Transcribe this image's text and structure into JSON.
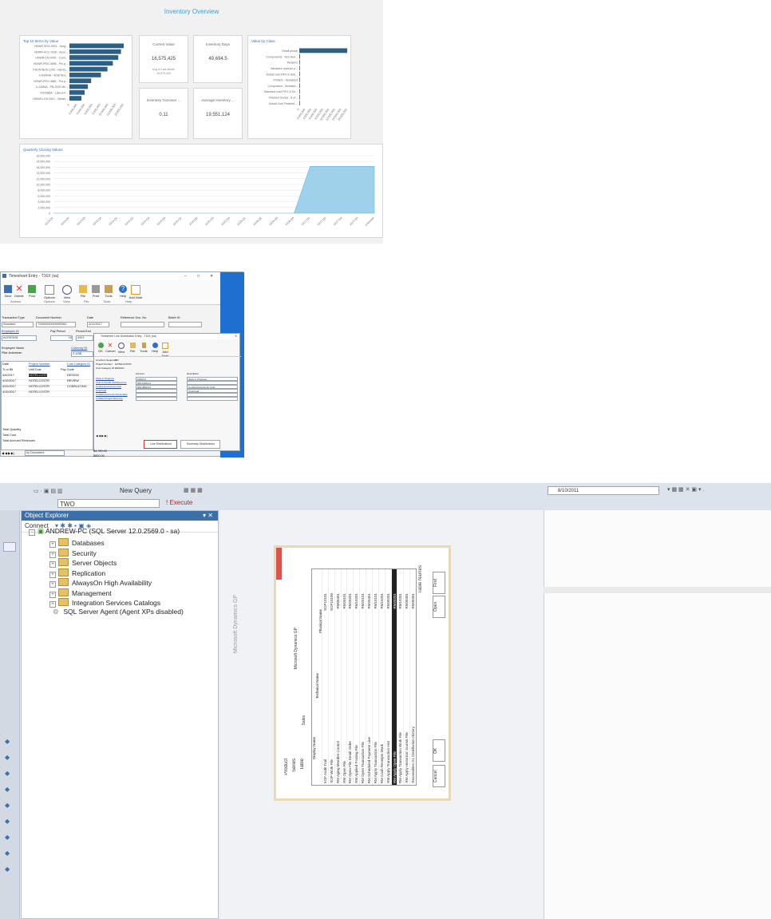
{
  "dashboard": {
    "title": "Inventory Overview",
    "top10": {
      "title": "Top 10 Items by Value",
      "items": [
        "HDWR-SRG-0001 - Surg...",
        "HDWR-ACC-0100 - Acce...",
        "HDWR-CM-0001 - Comi...",
        "HDWR-PRO-4896 - Pro p...",
        "PHON-BUS-1200 - Hands...",
        "2-A3954A - 4238 Sha...",
        "HDWR-PRO-4882 - Pro p...",
        "3-J2384A - PB-2320 Mo...",
        "4-B3386A - Lateral F...",
        "HDWR-LDS-0001 - Netwo..."
      ],
      "values": [
        100,
        95,
        90,
        80,
        70,
        58,
        40,
        34,
        28,
        22
      ],
      "x_ticks": [
        "0",
        "2,000,000",
        "4,000,000",
        "6,000,000",
        "8,000,000",
        "10,000,000",
        "12,000,000",
        "14,000,000"
      ]
    },
    "current_value": {
      "title": "Current Value",
      "value": "16,575,425",
      "sub1": "Avg of Last Month",
      "sub2": "16,875,425"
    },
    "inventory_days": {
      "title": "Inventory Days",
      "value": "49,694.5"
    },
    "turnover": {
      "title": "Inventory Turnover ...",
      "value": "0.11"
    },
    "avg_inventory": {
      "title": "Average Inventory ...",
      "value": "19,551,124"
    },
    "by_class": {
      "title": "Value by Class",
      "items": [
        "Retail phone",
        "Components - Non Seri...",
        "Modems",
        "Attractive contract p...",
        "Actual cost FIFO & Sub...",
        "Printers - Serialized",
        "Component - Serialize...",
        "Standard cost FIFO & Su...",
        "Finished Goods - 8 of...",
        "Actual Cost Finished ..."
      ],
      "values": [
        100,
        1.5,
        1,
        1,
        1,
        0.5,
        0.5,
        0.5,
        0.5,
        0.5
      ],
      "x_ticks": [
        "0",
        "2,000,000",
        "4,000,000",
        "6,000,000",
        "8,000,000",
        "10,000,000",
        "12,000,000",
        "14,000,000",
        "16,000,000"
      ]
    },
    "quarterly": {
      "title": "Quarterly Closing Values",
      "y_ticks": [
        "16,000,000",
        "14,000,000",
        "16,000,000",
        "14,000,000",
        "12,000,000",
        "10,000,000",
        "8,000,000",
        "6,000,000",
        "4,000,000",
        "2,000,000",
        "0"
      ],
      "x_ticks": [
        "2013-Q1",
        "2013-Q2",
        "2013-Q3",
        "2013-Q4",
        "2014-Q1",
        "2014-Q2",
        "2014-Q3",
        "2014-Q4",
        "2015-Q1",
        "2015-Q2",
        "2015-Q3",
        "2015-Q4",
        "2016-Q1",
        "2016-Q2",
        "2016-Q3",
        "2016-Q4",
        "2017-Q1",
        "2017-Q2",
        "2017-Q3",
        "2017-Q4",
        "Unknown"
      ],
      "values": [
        0,
        0,
        0,
        0,
        0,
        0,
        0,
        0,
        0,
        0,
        0,
        0,
        0,
        0,
        0,
        0,
        14500000,
        14500000,
        14500000,
        14500000,
        14500000
      ]
    }
  },
  "chart_data": [
    {
      "type": "bar",
      "title": "Top 10 Items by Value",
      "categories": [
        "HDWR-SRG-0001 - Surg...",
        "HDWR-ACC-0100 - Acce...",
        "HDWR-CM-0001 - Comi...",
        "HDWR-PRO-4896 - Pro p...",
        "PHON-BUS-1200 - Hands...",
        "2-A3954A - 4238 Sha...",
        "HDWR-PRO-4882 - Pro p...",
        "3-J2384A - PB-2320 Mo...",
        "4-B3386A - Lateral F...",
        "HDWR-LDS-0001 - Netwo..."
      ],
      "values": [
        14000000,
        13300000,
        12600000,
        11200000,
        9800000,
        8100000,
        5600000,
        4800000,
        3900000,
        3100000
      ],
      "xlim": [
        0,
        14000000
      ]
    },
    {
      "type": "bar",
      "title": "Value by Class",
      "categories": [
        "Retail phone",
        "Components - Non Seri...",
        "Modems",
        "Attractive contract p...",
        "Actual cost FIFO & Sub...",
        "Printers - Serialized",
        "Component - Serialize...",
        "Standard cost FIFO & Su...",
        "Finished Goods - 8 of...",
        "Actual Cost Finished ..."
      ],
      "values": [
        16000000,
        240000,
        160000,
        160000,
        160000,
        80000,
        80000,
        80000,
        80000,
        80000
      ],
      "xlim": [
        0,
        16000000
      ]
    },
    {
      "type": "area",
      "title": "Quarterly Closing Values",
      "x": [
        "2013-Q1",
        "2013-Q2",
        "2013-Q3",
        "2013-Q4",
        "2014-Q1",
        "2014-Q2",
        "2014-Q3",
        "2014-Q4",
        "2015-Q1",
        "2015-Q2",
        "2015-Q3",
        "2015-Q4",
        "2016-Q1",
        "2016-Q2",
        "2016-Q3",
        "2016-Q4",
        "2017-Q1",
        "2017-Q2",
        "2017-Q3",
        "2017-Q4",
        "Unknown"
      ],
      "values": [
        0,
        0,
        0,
        0,
        0,
        0,
        0,
        0,
        0,
        0,
        0,
        0,
        0,
        0,
        0,
        0,
        14500000,
        14500000,
        14500000,
        14500000,
        14500000
      ],
      "ylim": [
        0,
        16000000
      ]
    }
  ],
  "timesheet": {
    "window_title": "Timesheet Entry - T16X (sa)",
    "ribbon": {
      "buttons": [
        "Save",
        "Delete",
        "Post",
        "Options",
        "View",
        "File",
        "Print",
        "Tools",
        "Help",
        "Add Note"
      ],
      "groups": [
        "Actions",
        "Options",
        "View",
        "File",
        "Tools",
        "Help"
      ]
    },
    "labels": {
      "transaction_type": "Transaction Type",
      "document_number": "Document Number",
      "date": "Date",
      "reference_doc": "Reference Doc. No.",
      "batch_id": "Batch ID",
      "employee_id": "Employee ID",
      "from_period": "Pay Period",
      "period_end": "Period End",
      "employee_name": "Employee Name",
      "currency_id": "Currency ID",
      "date_col": "Date",
      "project_number": "Project Number",
      "cost_category": "Cost Category ID",
      "tr_qty": "Tr or Bil",
      "unit_cost": "Unit Cost",
      "pay_code": "Pay Code",
      "total_quantity": "Total Quantity",
      "total_cost": "Total Cost",
      "total_accrued": "Total Accrued Revenues",
      "by_document": "by Document"
    },
    "values": {
      "transaction_type": "Standard",
      "document_number": "TS000000000000062",
      "date": "4/12/2017",
      "employee_id": "ACEE0001",
      "pay_period": "15",
      "period_end": "4/9/2",
      "employee_name": "Pilar Ackerman",
      "currency_id": "Z-US$",
      "total_cost": "$4,760.00",
      "total_accrued": "$800.00"
    },
    "rows": [
      {
        "date": "4/4/2017",
        "project": "HOTELCOST",
        "cat": "DESIGN",
        "highlight": true
      },
      {
        "date": "4/10/2017",
        "project": "HOTELCOSTR",
        "cat": "REVIEW",
        "highlight": false
      },
      {
        "date": "4/10/2017",
        "project": "HOTELCOSTR",
        "cat": "CONSULTING",
        "highlight": false
      },
      {
        "date": "4/10/2017",
        "project": "HOTELCOSTR",
        "cat": "",
        "highlight": false
      }
    ],
    "dist": {
      "title": "Timesheet Line Distribution Entry - T16X (sa)",
      "buttons": [
        "OK",
        "Cancel",
        "View",
        "File",
        "Tools",
        "Help",
        "Add Note"
      ],
      "groups": [
        "Actions",
        "View",
        "File",
        "Tools",
        "Help"
      ],
      "info_labels": [
        "Line/Item Sequence",
        "Project Number",
        "Cost Category ID"
      ],
      "info_values": [
        "ON",
        "HOTELCOSTR",
        "DESIGN"
      ],
      "col_account": "Account",
      "col_description": "Description",
      "links": [
        "Work in Progress",
        "Cost of Goods Sold/Expense",
        "Contra Account for Cost",
        "Overhead",
        "Unbilled Accounts Receivable",
        "Unbilled Project Revenue"
      ],
      "accounts": [
        "1000-01",
        "000-1000-01",
        "000-4800-01",
        "",
        "",
        ""
      ],
      "descriptions": [
        "Work in Progress",
        "",
        "Contra Accounts for Cost",
        "Overhead",
        "",
        ""
      ],
      "btn_line": "Line Distributions",
      "btn_summary": "Summary Distributions"
    }
  },
  "ssms": {
    "toolbar": {
      "db_select": "TWO",
      "new_query": "New Query",
      "execute": "Execute",
      "right_value": "8/10/2011"
    },
    "object_explorer": {
      "title": "Object Explorer",
      "connect": "Connect",
      "server": "ANDREW-PC (SQL Server 12.0.2569.0 - sa)",
      "nodes": [
        "Databases",
        "Security",
        "Server Objects",
        "Replication",
        "AlwaysOn High Availability",
        "Management",
        "Integration Services Catalogs"
      ],
      "agent": "SQL Server Agent (Agent XPs disabled)"
    },
    "dialog": {
      "title": "Table Names",
      "labels": [
        "Product",
        "Series",
        "Table"
      ],
      "values": [
        "Microsoft Dynamics GP",
        "Sales",
        ""
      ],
      "columns": [
        "Display Name",
        "Technical Name",
        "Physical Name"
      ],
      "rows": [
        [
          "SOP Audit Trail",
          "SOP10101",
          ""
        ],
        [
          "SOP Work File",
          "SOP10100",
          ""
        ],
        [
          "RM Aging Member Control",
          "RM00401",
          ""
        ],
        [
          "RM Open File",
          "RM20101",
          ""
        ],
        [
          "RM Open File Detail Order",
          "RM20201",
          ""
        ],
        [
          "RM Applied Posting File",
          "RM10201",
          ""
        ],
        [
          "RM Open Transaction File",
          "RM20101",
          ""
        ],
        [
          "RM Scheduled Payment Line",
          "RM20401",
          ""
        ],
        [
          "RM Apply Transaction File",
          "RM10101",
          ""
        ],
        [
          "RM Cash Receipts Work",
          "RM10201",
          ""
        ],
        [
          "RM Apply Transaction Hist",
          "RM30201",
          ""
        ],
        [
          "RM Apply Open File",
          "RM20201",
          ""
        ],
        [
          "RM Apply Transaction Work File",
          "RM10201",
          ""
        ],
        [
          "RM Apply Historical Journal File",
          "RM30301",
          ""
        ],
        [
          "Receivables GL Distribution History",
          "RM30301",
          ""
        ]
      ],
      "buttons": [
        "Find",
        "Open",
        "OK",
        "Cancel"
      ]
    }
  },
  "colors": {
    "accent": "#3aa0d8",
    "bar": "#2b5f86",
    "area": "#9fd1ea",
    "ssms_blue": "#3c6ea8"
  }
}
